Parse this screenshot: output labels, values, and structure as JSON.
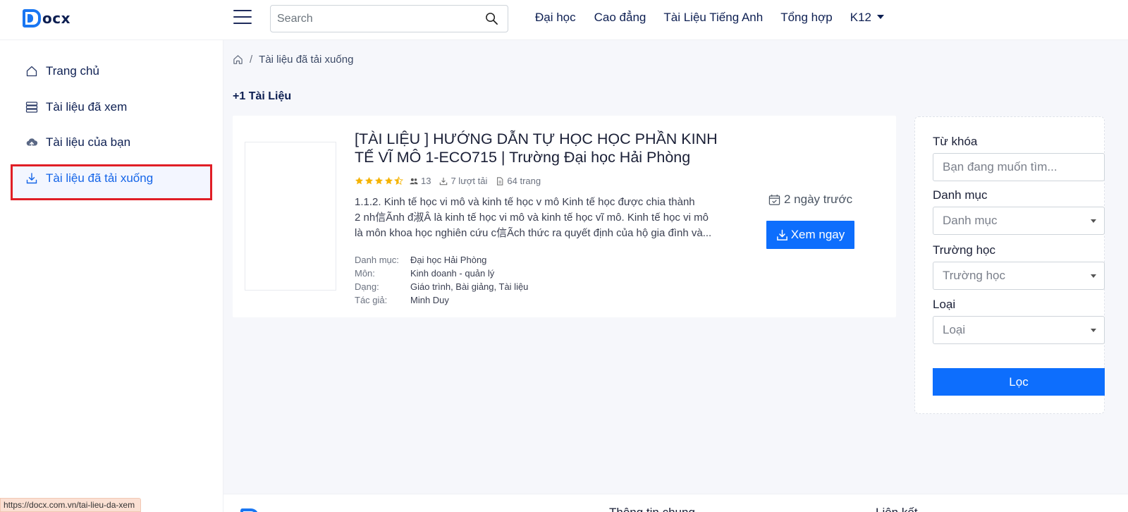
{
  "header": {
    "logo_text": "ocx",
    "search_placeholder": "Search",
    "nav": [
      "Đại học",
      "Cao đẳng",
      "Tài Liệu Tiếng Anh",
      "Tổng hợp",
      "K12"
    ]
  },
  "sidebar": {
    "items": [
      {
        "label": "Trang chủ",
        "icon": "home-icon"
      },
      {
        "label": "Tài liệu đã xem",
        "icon": "list-icon"
      },
      {
        "label": "Tài liệu của bạn",
        "icon": "cloud-upload-icon"
      },
      {
        "label": "Tài liệu đã tải xuống",
        "icon": "download-icon",
        "active": true
      }
    ]
  },
  "breadcrumb": {
    "current": "Tài liệu đã tải xuống"
  },
  "count_label": "+1 Tài Liệu",
  "document": {
    "title": "[TÀI LIỆU ] HƯỚNG DẪN TỰ HỌC HỌC PHẦN KINH TẾ VĨ MÔ 1-ECO715 | Trường Đại học Hải Phòng",
    "rating": 4.5,
    "rating_users": "13",
    "downloads": "7 lượt tải",
    "pages": "64 trang",
    "desc_lines": [
      "1.1.2. Kinh tế học vi mô và kinh tế học v     mô Kinh tế học được chia thành",
      "2 nh信Ãnh đ淑Â là kinh tế học vi mô và kinh tế học vĩ mô. Kinh tế học vi mô",
      "là môn khoa học nghiên cứu c信Ãch thức ra quyết định của hộ gia đình và..."
    ],
    "details": [
      {
        "key": "Danh mục:",
        "value": "Đại học Hải Phòng"
      },
      {
        "key": "Môn:",
        "value": "Kinh doanh - quản lý"
      },
      {
        "key": "Dạng:",
        "value": "Giáo trình, Bài giảng, Tài liệu"
      },
      {
        "key": "Tác giả:",
        "value": "Minh Duy"
      }
    ],
    "time": "2 ngày trước",
    "view_button": "Xem ngay"
  },
  "filter": {
    "keyword_label": "Từ khóa",
    "keyword_placeholder": "Bạn đang muốn tìm...",
    "category_label": "Danh mục",
    "category_value": "Danh mục",
    "school_label": "Trường học",
    "school_value": "Trường học",
    "type_label": "Loại",
    "type_value": "Loại",
    "submit": "Lọc"
  },
  "footer": {
    "heading_1": "Thông tin chung",
    "heading_2": "Liên kết"
  },
  "status_url": "https://docx.com.vn/tai-lieu-da-xem",
  "colors": {
    "accent": "#0d6efd",
    "nav_text": "#0d1f52",
    "star": "#f5b301",
    "highlight_border": "#e01e26"
  }
}
